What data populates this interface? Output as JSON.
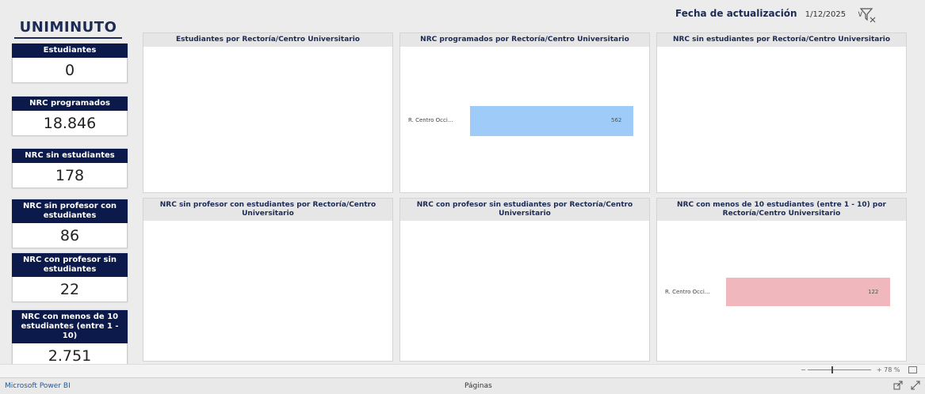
{
  "header": {
    "brand": "UNIMINUTO",
    "update_label": "Fecha de actualización",
    "update_date": "1/12/2025",
    "dropdown_glyph": "∨",
    "filter_icon": "filter-clear-icon"
  },
  "kpis": [
    {
      "label": "Estudiantes",
      "value": "0"
    },
    {
      "label": "NRC programados",
      "value": "18.846"
    },
    {
      "label": "NRC sin estudiantes",
      "value": "178"
    },
    {
      "label": "NRC sin profesor con estudiantes",
      "value": "86"
    },
    {
      "label": "NRC con profesor sin estudiantes",
      "value": "22"
    },
    {
      "label": "NRC con menos de 10 estudiantes (entre 1 - 10)",
      "value": "2.751"
    }
  ],
  "panels": [
    {
      "title": "Estudiantes por Rectoría/Centro Universitario"
    },
    {
      "title": "NRC programados por Rectoría/Centro Universitario"
    },
    {
      "title": "NRC sin estudiantes por Rectoría/Centro Universitario"
    },
    {
      "title": "NRC sin profesor con estudiantes por Rectoría/Centro Universitario"
    },
    {
      "title": "NRC con profesor sin estudiantes por Rectoría/Centro Universitario"
    },
    {
      "title": "NRC con menos de 10 estudiantes (entre 1 - 10) por Rectoría/Centro Universitario"
    }
  ],
  "chart_data": [
    {
      "type": "bar",
      "orientation": "horizontal",
      "title": "NRC programados por Rectoría/Centro Universitario",
      "categories": [
        "R. Centro Occi..."
      ],
      "values": [
        562
      ],
      "color": "#9ecbf7"
    },
    {
      "type": "bar",
      "orientation": "horizontal",
      "title": "NRC con menos de 10 estudiantes (entre 1 - 10) por Rectoría/Centro Universitario",
      "categories": [
        "R. Centro Occi..."
      ],
      "values": [
        122
      ],
      "color": "#f0b8bc"
    }
  ],
  "footer": {
    "app_name": "Microsoft Power BI",
    "pages_label": "Páginas",
    "zoom_minus": "−",
    "zoom_plus": "+",
    "zoom_level": "78 %"
  }
}
